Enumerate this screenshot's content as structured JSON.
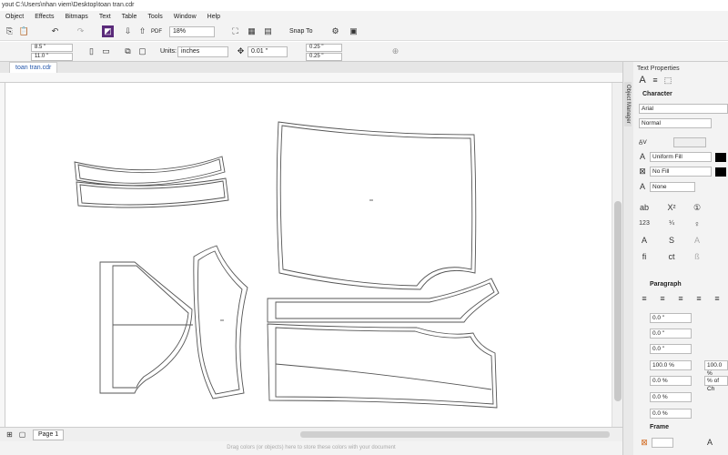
{
  "window": {
    "title": "yout   C:\\Users\\nhan viem\\Desktop\\toan tran.cdr"
  },
  "menu": [
    "Object",
    "Effects",
    "Bitmaps",
    "Text",
    "Table",
    "Tools",
    "Window",
    "Help"
  ],
  "toolbar": {
    "zoom": "18%",
    "snap_to": "Snap To",
    "pdf_label": "PDF"
  },
  "property_bar": {
    "width": "8.5 \"",
    "height": "11.0 \"",
    "units_label": "Units:",
    "units_value": "inches",
    "nudge": "0.01 \"",
    "dup_x": "0.25 \"",
    "dup_y": "0.25 \""
  },
  "document_tab": "toan tran.cdr",
  "page_tab": "Page 1",
  "status_text": "Drag colors (or objects) here to store these colors with your document",
  "side_docker_tab": "Object Manager",
  "panel": {
    "title": "Text Properties",
    "character_header": "Character",
    "font": "Arial",
    "style": "Normal",
    "fill_type": "Uniform Fill",
    "bg_fill": "No Fill",
    "outline": "None",
    "paragraph_header": "Paragraph",
    "indent1": "0.0 \"",
    "indent2": "0.0 \"",
    "indent3": "0.0 \"",
    "spacing1": "0.0 \"",
    "line_spacing": "100.0 %",
    "line_spacing_r": "100.0 %",
    "char_spacing": "0.0 %",
    "char_spacing_r": "% of Ch",
    "word_spacing": "0.0 %",
    "lang_spacing": "0.0 %",
    "spacing_last": "0.0 %",
    "frame_header": "Frame"
  },
  "colors": {
    "accent": "#2255aa",
    "pattern_line": "#555555",
    "panel_bg": "#f3f3f3"
  }
}
